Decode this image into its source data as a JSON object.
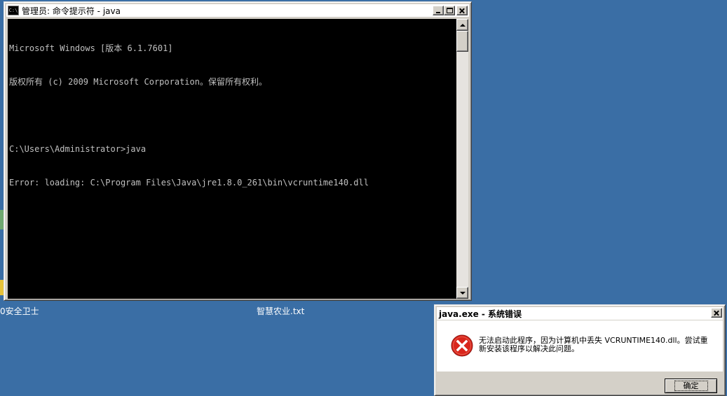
{
  "desktop": {
    "icons": [
      {
        "label": "0安全卫士"
      },
      {
        "label": "智慧农业.txt"
      }
    ],
    "background_color": "#3a6ea5"
  },
  "cmd_window": {
    "title": "管理员: 命令提示符 - java",
    "app_icon_text": "C:\\",
    "console_lines": [
      "Microsoft Windows [版本 6.1.7601]",
      "版权所有 (c) 2009 Microsoft Corporation。保留所有权利。",
      "",
      "C:\\Users\\Administrator>java",
      "Error: loading: C:\\Program Files\\Java\\jre1.8.0_261\\bin\\vcruntime140.dll"
    ],
    "console_colors": {
      "background": "#000000",
      "text": "#c0c0c0"
    }
  },
  "error_dialog": {
    "title": "java.exe - 系统错误",
    "message": "无法启动此程序，因为计算机中丢失 VCRUNTIME140.dll。尝试重新安装该程序以解决此问题。",
    "ok_label": "确定",
    "icon": "error-icon",
    "icon_color": "#d9261c"
  }
}
